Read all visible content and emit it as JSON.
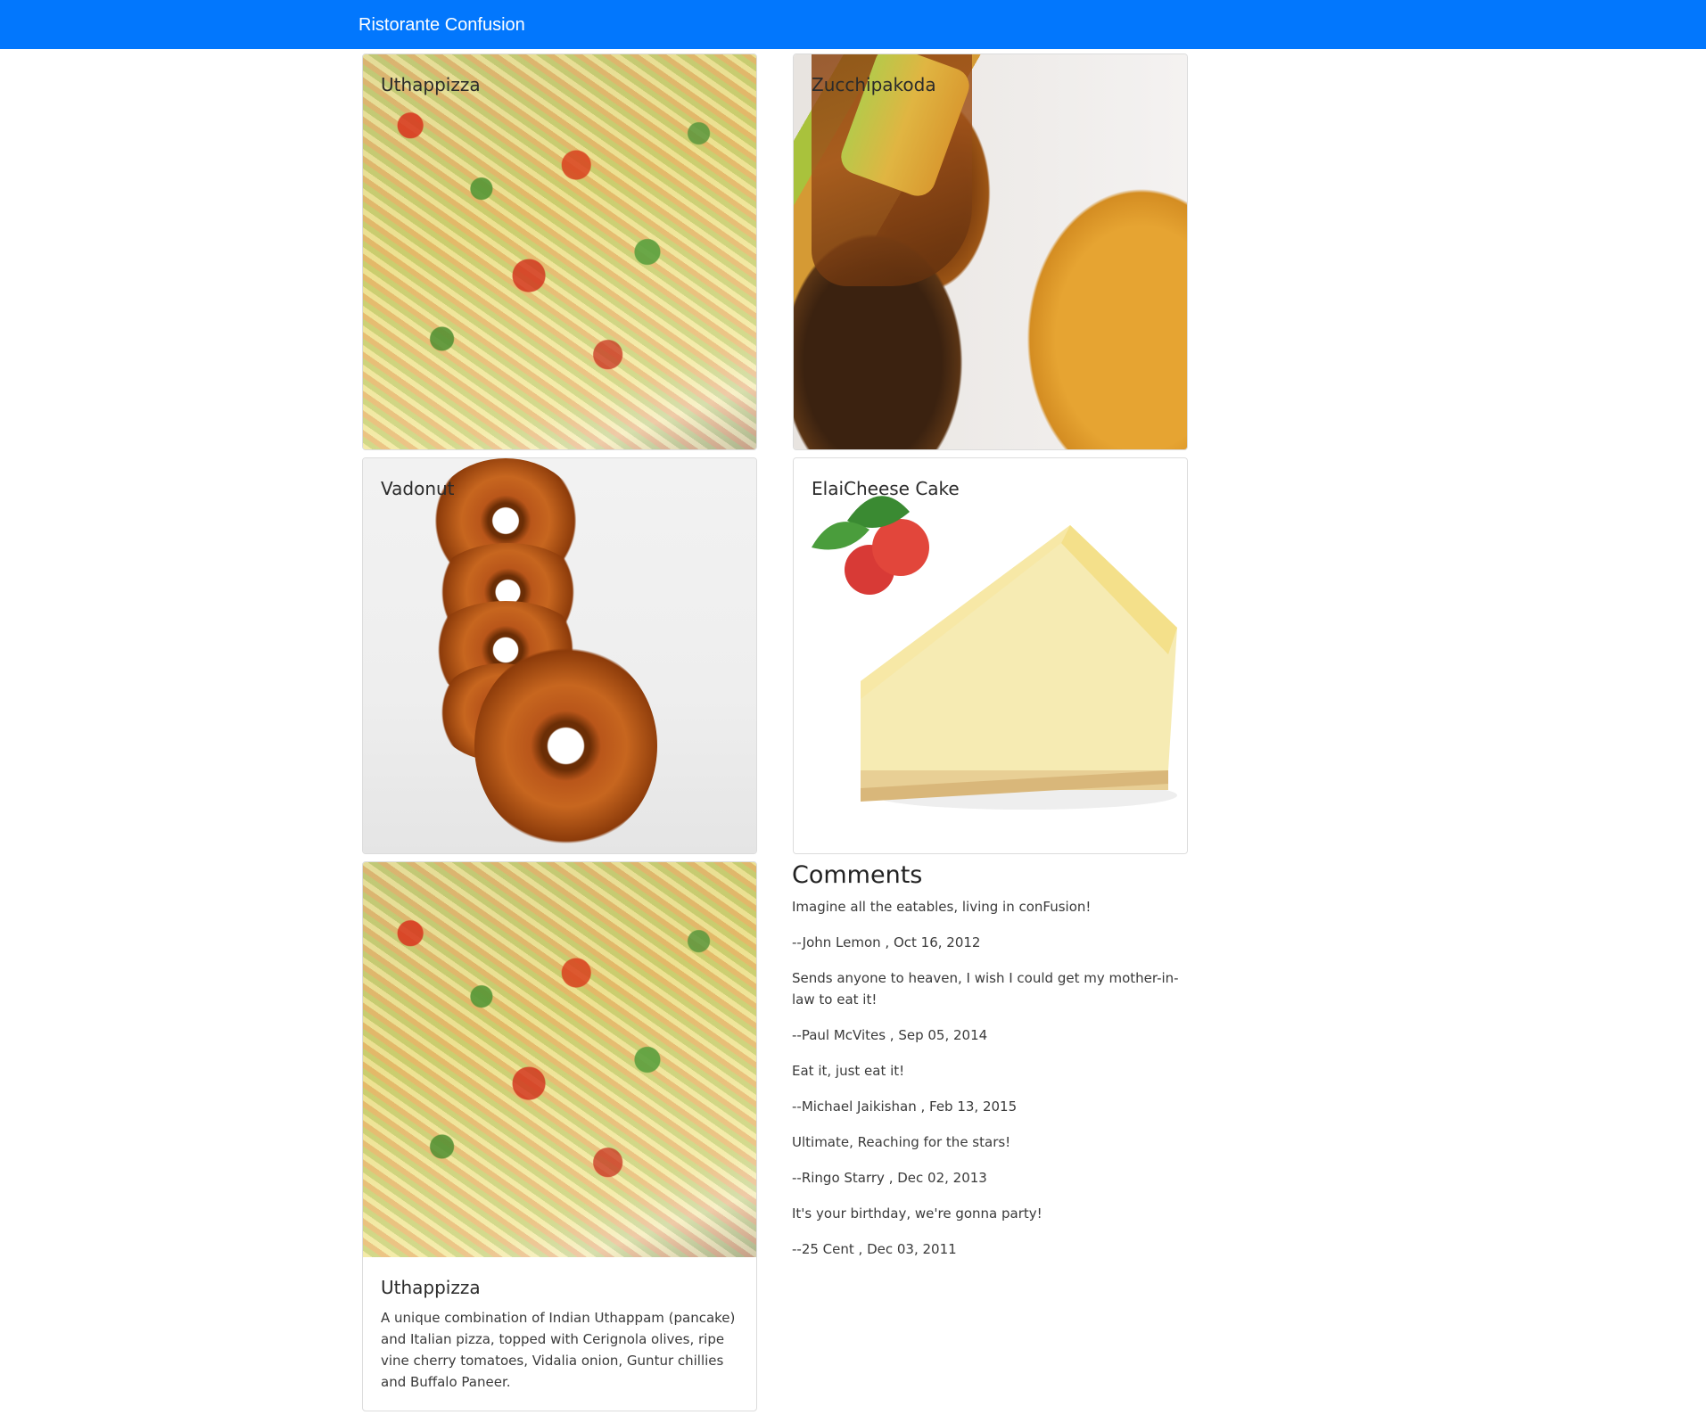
{
  "navbar": {
    "brand": "Ristorante Confusion"
  },
  "dishes": [
    {
      "name": "Uthappizza",
      "image_icon": "pizza-image"
    },
    {
      "name": "Zucchipakoda",
      "image_icon": "pakoda-image"
    },
    {
      "name": "Vadonut",
      "image_icon": "donut-image"
    },
    {
      "name": "ElaiCheese Cake",
      "image_icon": "cheesecake-image"
    }
  ],
  "selected_dish": {
    "name": "Uthappizza",
    "description": "A unique combination of Indian Uthappam (pancake) and Italian pizza, topped with Cerignola olives, ripe vine cherry tomatoes, Vidalia onion, Guntur chillies and Buffalo Paneer."
  },
  "comments": {
    "heading": "Comments",
    "items": [
      {
        "text": "Imagine all the eatables, living in conFusion!",
        "byline": "--John Lemon , Oct 16, 2012"
      },
      {
        "text": "Sends anyone to heaven, I wish I could get my mother-in-law to eat it!",
        "byline": "--Paul McVites , Sep 05, 2014"
      },
      {
        "text": "Eat it, just eat it!",
        "byline": "--Michael Jaikishan , Feb 13, 2015"
      },
      {
        "text": "Ultimate, Reaching for the stars!",
        "byline": "--Ringo Starry , Dec 02, 2013"
      },
      {
        "text": "It's your birthday, we're gonna party!",
        "byline": "--25 Cent , Dec 03, 2011"
      }
    ]
  }
}
